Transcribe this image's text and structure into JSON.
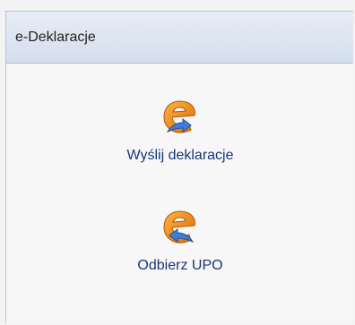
{
  "panel": {
    "title": "e-Deklaracje",
    "actions": [
      {
        "label": "Wyślij deklaracje",
        "icon": "e-declaration-send-icon"
      },
      {
        "label": "Odbierz UPO",
        "icon": "e-declaration-receive-icon"
      }
    ]
  },
  "colors": {
    "header_top": "#e7edf6",
    "header_bottom": "#d4deec",
    "label_text": "#17367a",
    "icon_orange": "#f08a18",
    "icon_blue": "#3f7fd8"
  }
}
